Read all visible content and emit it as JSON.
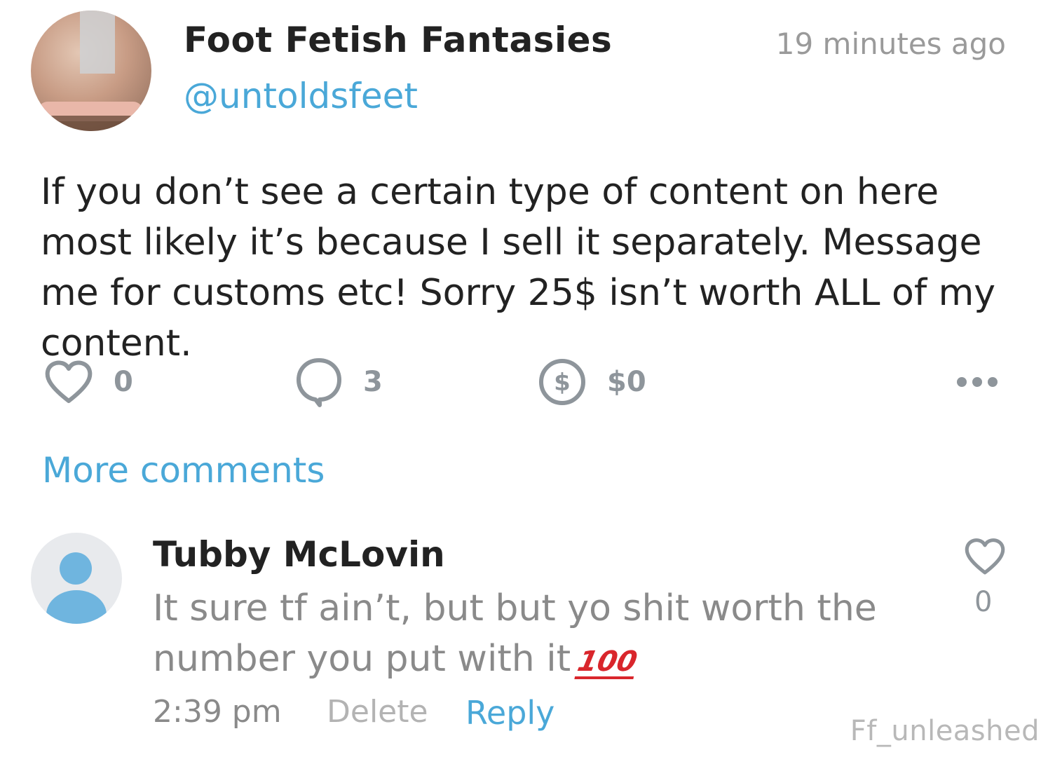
{
  "post": {
    "author_name": "Foot Fetish Fantasies",
    "author_handle": "@untoldsfeet",
    "timestamp": "19 minutes ago",
    "body": "If you don’t see a certain type of content on here most likely it’s because I sell it separately. Message me for customs etc! Sorry 25$ isn’t worth ALL of my content.",
    "actions": {
      "likes": "0",
      "comments": "3",
      "tips": "$0",
      "icons": [
        "heart-icon",
        "comment-bubble-icon",
        "dollar-coin-icon",
        "more-dots-icon"
      ]
    }
  },
  "more_comments_label": "More comments",
  "comment": {
    "author_name": "Tubby McLovin",
    "text": "It sure tf ain’t, but but yo shit worth the number you put with it",
    "emoji": "100",
    "time": "2:39 pm",
    "delete_label": "Delete",
    "reply_label": "Reply",
    "likes": "0"
  },
  "watermark": "Ff_unleashed",
  "colors": {
    "accent_blue": "#4aa8d8",
    "icon_gray": "#8e959b",
    "text_dark": "#222222",
    "text_muted": "#8a8a8a",
    "emoji_red": "#d9262c"
  }
}
